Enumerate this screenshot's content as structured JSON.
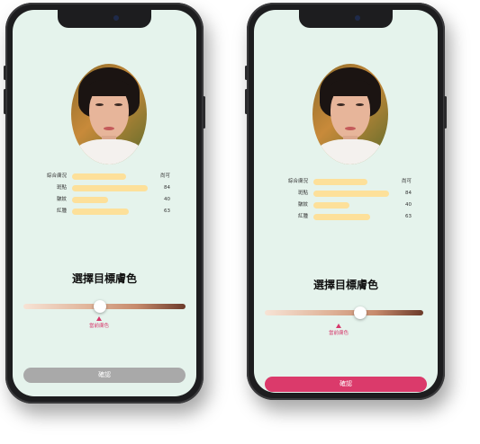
{
  "colors": {
    "screen_bg": "#e5f3ec",
    "bar": "#fde09a",
    "accent": "#d6386b",
    "confirm_disabled": "#a9a9a9",
    "confirm_active": "#db3a6b"
  },
  "screens": [
    {
      "state": "disabled",
      "metrics": [
        {
          "label": "綜合膚況",
          "value": "尚可",
          "level": 0.6
        },
        {
          "label": "斑點",
          "value": "84",
          "level": 0.84
        },
        {
          "label": "皺紋",
          "value": "40",
          "level": 0.4
        },
        {
          "label": "紅腫",
          "value": "63",
          "level": 0.63
        }
      ],
      "heading": "選擇目標膚色",
      "slider_level": 0.47,
      "current_label": "當前膚色",
      "confirm_label": "確認"
    },
    {
      "state": "active",
      "metrics": [
        {
          "label": "綜合膚況",
          "value": "尚可",
          "level": 0.6
        },
        {
          "label": "斑點",
          "value": "84",
          "level": 0.84
        },
        {
          "label": "皺紋",
          "value": "40",
          "level": 0.4
        },
        {
          "label": "紅腫",
          "value": "63",
          "level": 0.63
        }
      ],
      "heading": "選擇目標膚色",
      "slider_level": 0.6,
      "current_label": "當前膚色",
      "confirm_label": "確認"
    }
  ]
}
